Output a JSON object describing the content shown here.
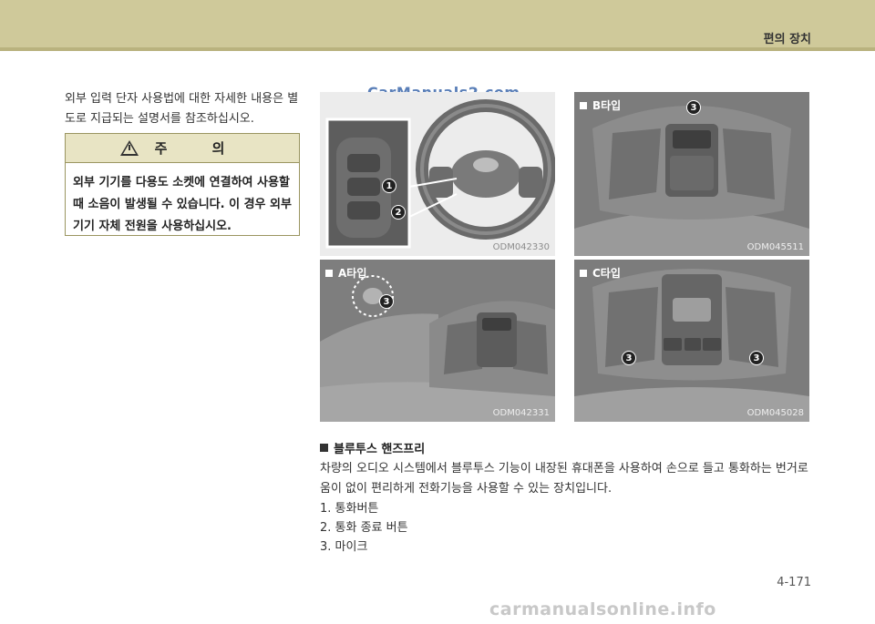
{
  "header": {
    "section_title": "편의 장치"
  },
  "intro": {
    "text": "외부 입력 단자 사용법에 대한 자세한 내용은 별도로 지급되는 설명서를 참조하십시오."
  },
  "caution": {
    "title": "주 의",
    "body": "외부 기기를 다용도 소켓에 연결하여 사용할 때 소음이 발생될 수 있습니다. 이 경우 외부 기기 자체 전원을 사용하십시오."
  },
  "watermark_top": "CarManuals2.com",
  "figures": {
    "steering": {
      "code": "ODM042330",
      "callouts": [
        "1",
        "2"
      ]
    },
    "type_a": {
      "label": "A타입",
      "code": "ODM042331",
      "callout": "3"
    },
    "type_b": {
      "label": "B타입",
      "code": "ODM045511",
      "callout": "3"
    },
    "type_c": {
      "label": "C타입",
      "code": "ODM045028",
      "callouts": [
        "3",
        "3"
      ]
    }
  },
  "bluetooth": {
    "heading": "블루투스 핸즈프리",
    "description": "차량의 오디오 시스템에서 블루투스 기능이 내장된 휴대폰을 사용하여 손으로 들고 통화하는 번거로움이 없이 편리하게 전화기능을 사용할 수 있는 장치입니다.",
    "items": [
      "1.  통화버튼",
      "2.  통화 종료 버튼",
      "3. 마이크"
    ]
  },
  "page_number": "4-171",
  "footer_watermark": "carmanualsonline.info",
  "colors": {
    "header_band": "#cfc99a",
    "caution_head": "#e8e4c4"
  }
}
